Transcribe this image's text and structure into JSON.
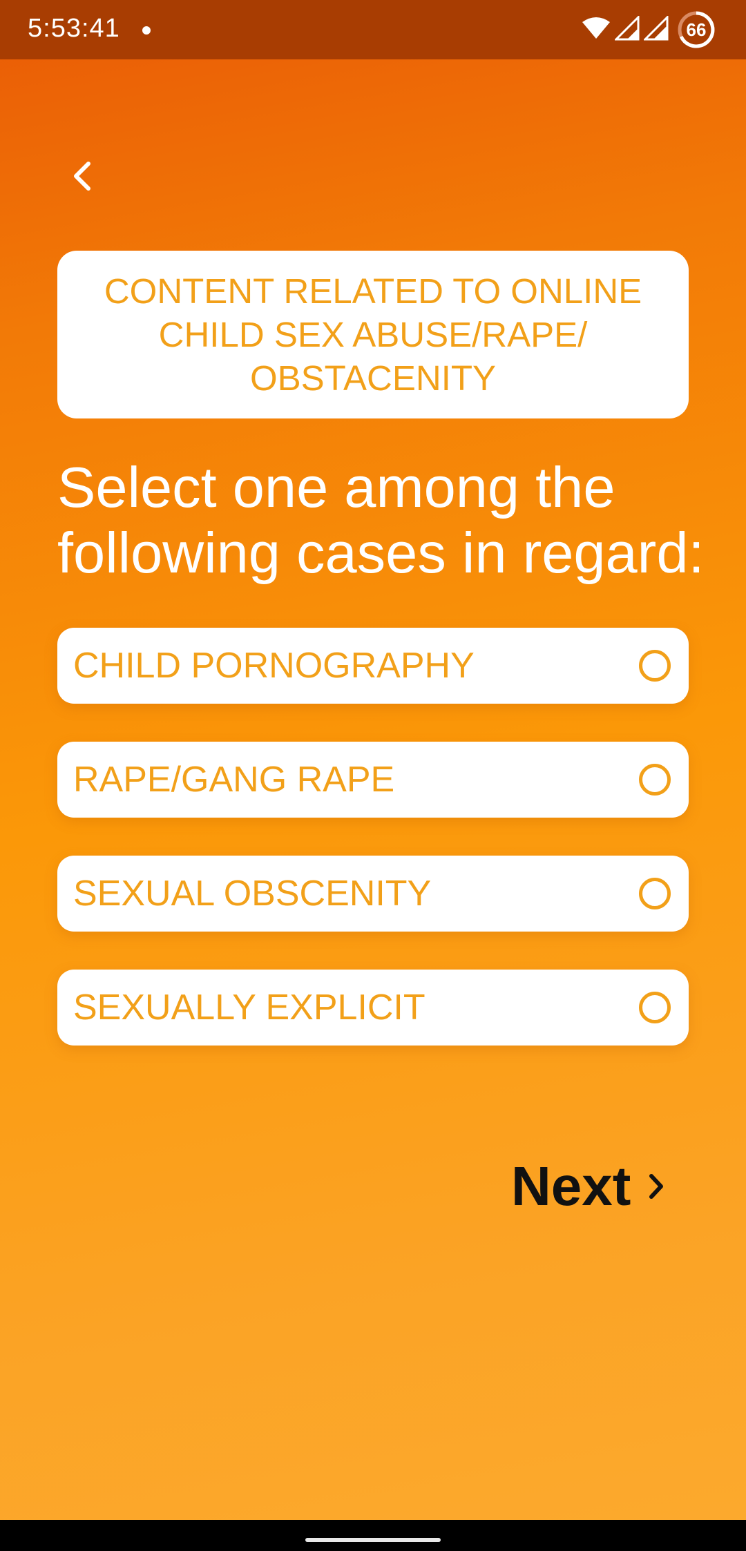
{
  "status_bar": {
    "time": "5:53:41",
    "battery_level": "66"
  },
  "header": {
    "title": "CONTENT RELATED TO ONLINE CHILD SEX ABUSE/RAPE/ OBSTACENITY"
  },
  "prompt": "Select one among the following cases in regard:",
  "options": [
    {
      "label": "CHILD PORNOGRAPHY",
      "selected": false
    },
    {
      "label": "RAPE/GANG RAPE",
      "selected": false
    },
    {
      "label": "SEXUAL OBSCENITY",
      "selected": false
    },
    {
      "label": "SEXUALLY EXPLICIT",
      "selected": false
    }
  ],
  "actions": {
    "next_label": "Next"
  },
  "colors": {
    "accent": "#f2a019",
    "status_bar": "#a83d02",
    "gradient_top": "#e95a05",
    "gradient_bottom": "#fcaa2e"
  },
  "icons": {
    "back": "chevron-left-icon",
    "next": "chevron-right-icon",
    "wifi": "wifi-icon",
    "signal": "cell-signal-icon",
    "battery": "battery-icon"
  }
}
